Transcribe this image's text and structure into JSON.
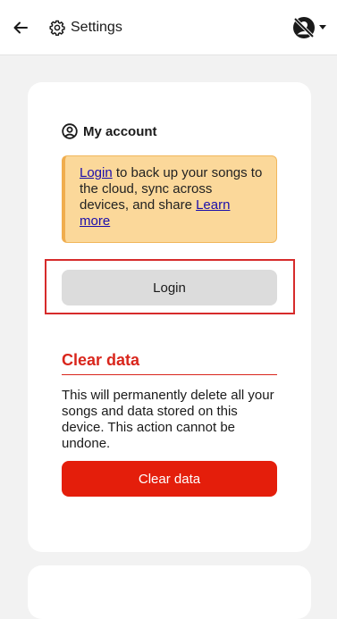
{
  "header": {
    "title": "Settings",
    "icons": {
      "back": "arrow-left-icon",
      "settings": "gear-icon",
      "account": "user-offline-icon",
      "menu": "chevron-down-icon"
    }
  },
  "account_section": {
    "title": "My account",
    "icon": "user-circle-icon",
    "notice": {
      "link_login": "Login",
      "text": " to back up your songs to the cloud, sync across devices, and share ",
      "link_learn_more": "Learn more"
    },
    "login_button": "Login"
  },
  "danger_section": {
    "title": "Clear data",
    "description": "This will permanently delete all your songs and data stored on this device. This action cannot be undone.",
    "button": "Clear data"
  },
  "colors": {
    "danger": "#e41e0b",
    "notice_bg": "#fbd89a",
    "notice_border": "#f0ad4e",
    "highlight_frame": "#d62b2b",
    "link": "#1a0dab"
  }
}
